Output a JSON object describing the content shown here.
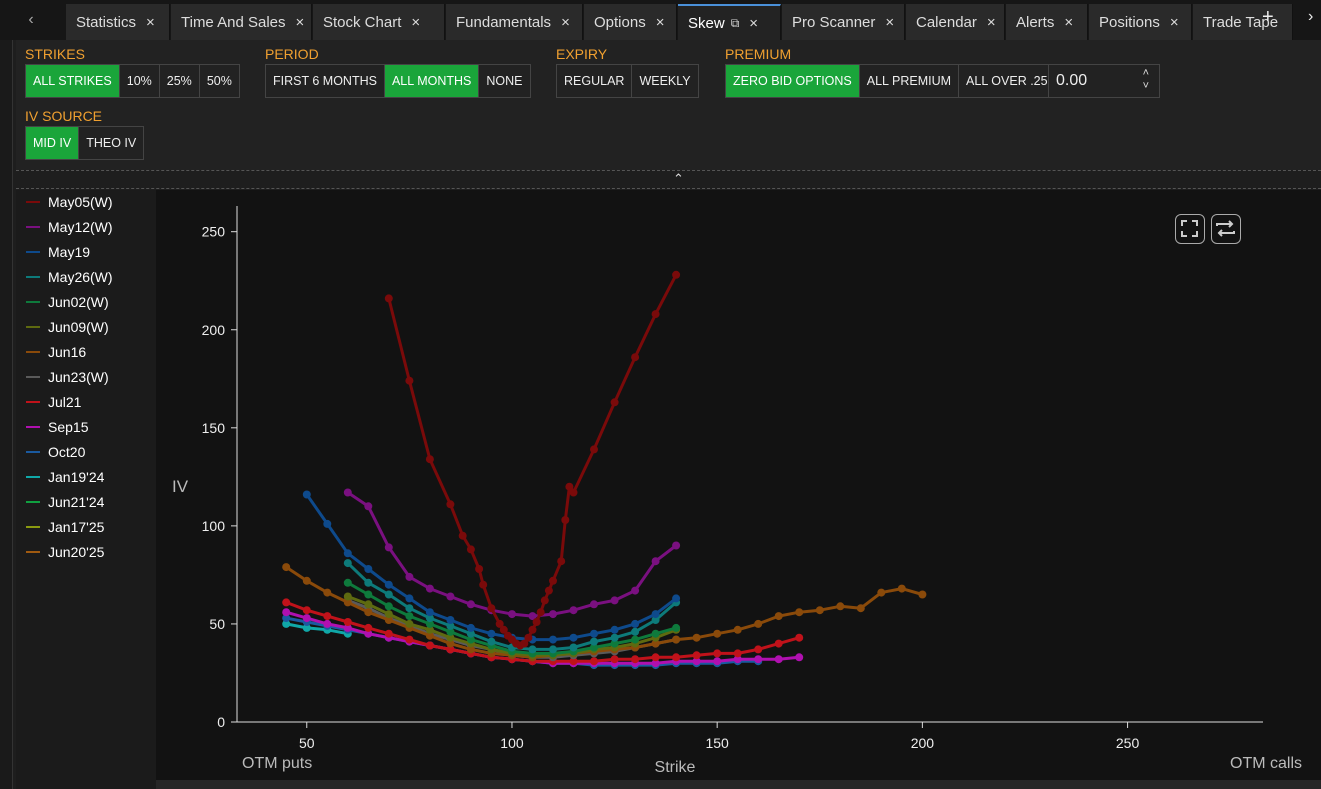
{
  "tabs": [
    {
      "label": "Statistics"
    },
    {
      "label": "Time And Sales"
    },
    {
      "label": "Stock Chart"
    },
    {
      "label": "Fundamentals"
    },
    {
      "label": "Options"
    },
    {
      "label": "Skew",
      "active": true
    },
    {
      "label": "Pro Scanner"
    },
    {
      "label": "Calendar"
    },
    {
      "label": "Alerts"
    },
    {
      "label": "Positions"
    },
    {
      "label": "Trade Tape"
    }
  ],
  "controls": {
    "strikes": {
      "label": "STRIKES",
      "options": [
        "ALL STRIKES",
        "10%",
        "25%",
        "50%"
      ],
      "selected": "ALL STRIKES"
    },
    "period": {
      "label": "PERIOD",
      "options": [
        "FIRST 6 MONTHS",
        "ALL MONTHS",
        "NONE"
      ],
      "selected": "ALL MONTHS"
    },
    "expiry": {
      "label": "EXPIRY",
      "options": [
        "REGULAR",
        "WEEKLY"
      ],
      "selected": ""
    },
    "premium": {
      "label": "PREMIUM",
      "options": [
        "ZERO BID OPTIONS",
        "ALL PREMIUM",
        "ALL OVER .25"
      ],
      "selected": "ZERO BID OPTIONS",
      "value": "0.00"
    },
    "iv_source": {
      "label": "IV SOURCE",
      "options": [
        "MID IV",
        "THEO IV"
      ],
      "selected": "MID IV"
    }
  },
  "colors": {
    "accent": "#1aa53a",
    "label": "#f0a030"
  },
  "chart_data": {
    "type": "line",
    "xlabel": "Strike",
    "ylabel": "IV",
    "x_left_note": "OTM puts",
    "x_right_note": "OTM calls",
    "xlim": [
      33,
      283
    ],
    "ylim": [
      0,
      258
    ],
    "xticks": [
      50,
      100,
      150,
      200,
      250
    ],
    "yticks": [
      0,
      50,
      100,
      150,
      200,
      250
    ],
    "legend_position": "left",
    "series": [
      {
        "name": "May05(W)",
        "color": "#7a0a0a",
        "x": [
          70,
          75,
          80,
          85,
          88,
          90,
          92,
          93,
          95,
          97,
          98,
          99,
          100,
          101,
          102,
          103,
          104,
          105,
          106,
          107,
          108,
          109,
          110,
          112,
          113,
          114,
          115,
          120,
          125,
          130,
          135,
          140
        ],
        "values": [
          216,
          174,
          134,
          111,
          95,
          88,
          78,
          70,
          58,
          50,
          47,
          44,
          42,
          40,
          39,
          40,
          43,
          47,
          51,
          56,
          62,
          67,
          72,
          82,
          103,
          120,
          117,
          139,
          163,
          186,
          208,
          228
        ]
      },
      {
        "name": "May12(W)",
        "color": "#7a1080",
        "x": [
          60,
          65,
          70,
          75,
          80,
          85,
          90,
          95,
          100,
          105,
          110,
          115,
          120,
          125,
          130,
          135,
          140
        ],
        "values": [
          117,
          110,
          89,
          74,
          68,
          64,
          60,
          57,
          55,
          54,
          55,
          57,
          60,
          62,
          67,
          82,
          90
        ]
      },
      {
        "name": "May19",
        "color": "#0e4a8c",
        "x": [
          50,
          55,
          60,
          65,
          70,
          75,
          80,
          85,
          90,
          95,
          100,
          105,
          110,
          115,
          120,
          125,
          130,
          135,
          140
        ],
        "values": [
          116,
          101,
          86,
          78,
          70,
          63,
          56,
          52,
          48,
          45,
          43,
          42,
          42,
          43,
          45,
          47,
          50,
          55,
          63
        ]
      },
      {
        "name": "May26(W)",
        "color": "#0d7a7a",
        "x": [
          60,
          65,
          70,
          75,
          80,
          85,
          90,
          95,
          100,
          105,
          110,
          115,
          120,
          125,
          130,
          135,
          140
        ],
        "values": [
          81,
          71,
          65,
          58,
          53,
          49,
          45,
          41,
          38,
          37,
          37,
          38,
          41,
          43,
          46,
          52,
          61
        ]
      },
      {
        "name": "Jun02(W)",
        "color": "#0e7a3c",
        "x": [
          60,
          65,
          70,
          75,
          80,
          85,
          90,
          95,
          100,
          105,
          110,
          115,
          120,
          125,
          130,
          135,
          140
        ],
        "values": [
          71,
          65,
          59,
          54,
          50,
          46,
          42,
          39,
          36,
          35,
          35,
          36,
          38,
          40,
          42,
          45,
          48
        ]
      },
      {
        "name": "Jun09(W)",
        "color": "#5e6a10",
        "x": [
          60,
          65,
          70,
          75,
          80,
          85,
          90,
          95,
          100,
          105,
          110,
          115,
          120,
          125,
          130,
          135,
          140
        ],
        "values": [
          64,
          60,
          55,
          50,
          47,
          43,
          40,
          37,
          35,
          34,
          34,
          35,
          37,
          38,
          40,
          43,
          47
        ]
      },
      {
        "name": "Jun16",
        "color": "#8a4a0a",
        "x": [
          45,
          50,
          55,
          60,
          65,
          70,
          75,
          80,
          85,
          90,
          95,
          100,
          105,
          110,
          115,
          120,
          125,
          130,
          135,
          140,
          145,
          150,
          155,
          160,
          165,
          170,
          175,
          180,
          185,
          190,
          195,
          200
        ],
        "values": [
          79,
          72,
          66,
          61,
          56,
          52,
          48,
          44,
          40,
          37,
          35,
          34,
          33,
          34,
          35,
          36,
          37,
          38,
          40,
          42,
          43,
          45,
          47,
          50,
          54,
          56,
          57,
          59,
          58,
          66,
          68,
          65
        ]
      },
      {
        "name": "Jun23(W)",
        "color": "#5a5a5a",
        "x": [
          60,
          65,
          70,
          75,
          80,
          85,
          90,
          95,
          100,
          105,
          110,
          115,
          120,
          125,
          130,
          135,
          140
        ],
        "values": [
          62,
          58,
          53,
          49,
          45,
          42,
          39,
          37,
          34,
          33,
          33,
          34,
          35,
          36,
          38,
          40,
          42
        ]
      },
      {
        "name": "Jul21",
        "color": "#c0121a",
        "x": [
          45,
          50,
          55,
          60,
          65,
          70,
          75,
          80,
          85,
          90,
          95,
          100,
          105,
          110,
          115,
          120,
          125,
          130,
          135,
          140,
          145,
          150,
          155,
          160,
          165,
          170
        ],
        "values": [
          61,
          57,
          54,
          51,
          48,
          45,
          42,
          39,
          37,
          35,
          33,
          32,
          31,
          31,
          31,
          31,
          32,
          32,
          33,
          33,
          34,
          35,
          35,
          37,
          40,
          43
        ]
      },
      {
        "name": "Sep15",
        "color": "#b010b0",
        "x": [
          45,
          50,
          55,
          60,
          65,
          70,
          75,
          80,
          85,
          90,
          95,
          100,
          105,
          110,
          115,
          120,
          125,
          130,
          135,
          140,
          145,
          150,
          155,
          160,
          165,
          170
        ],
        "values": [
          56,
          53,
          50,
          48,
          45,
          43,
          41,
          39,
          37,
          35,
          33,
          32,
          31,
          30,
          30,
          30,
          30,
          30,
          30,
          31,
          31,
          31,
          32,
          32,
          32,
          33
        ]
      },
      {
        "name": "Oct20",
        "color": "#1a5aa0",
        "x": [
          45,
          50,
          55,
          60,
          65,
          70,
          75,
          80,
          85,
          90,
          95,
          100,
          105,
          110,
          115,
          120,
          125,
          130,
          135,
          140,
          145,
          150,
          155,
          160
        ],
        "values": [
          53,
          51,
          49,
          47,
          45,
          43,
          41,
          39,
          37,
          35,
          33,
          32,
          31,
          30,
          30,
          29,
          29,
          29,
          29,
          30,
          30,
          30,
          31,
          31
        ]
      },
      {
        "name": "Jan19'24",
        "color": "#10a8a8",
        "x": [
          45,
          50,
          55,
          60
        ],
        "values": [
          50,
          48,
          47,
          45
        ]
      },
      {
        "name": "Jun21'24",
        "color": "#10a040",
        "x": [],
        "values": []
      },
      {
        "name": "Jan17'25",
        "color": "#8a9a10",
        "x": [],
        "values": []
      },
      {
        "name": "Jun20'25",
        "color": "#a05a10",
        "x": [],
        "values": []
      }
    ]
  }
}
